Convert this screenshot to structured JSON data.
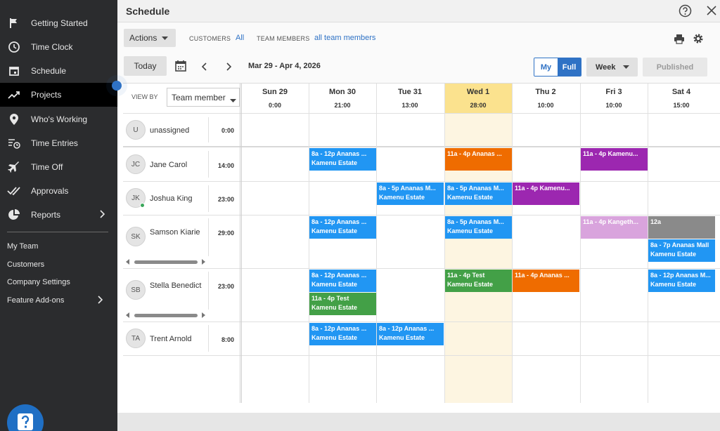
{
  "sidebar": {
    "items": [
      {
        "label": "Getting Started",
        "icon": "flag-icon"
      },
      {
        "label": "Time Clock",
        "icon": "clock-icon"
      },
      {
        "label": "Schedule",
        "icon": "calendar-icon"
      },
      {
        "label": "Projects",
        "icon": "trending-icon"
      },
      {
        "label": "Who's Working",
        "icon": "location-pin-icon"
      },
      {
        "label": "Time Entries",
        "icon": "time-entries-icon"
      },
      {
        "label": "Time Off",
        "icon": "airplane-icon"
      },
      {
        "label": "Approvals",
        "icon": "double-check-icon"
      },
      {
        "label": "Reports",
        "icon": "pie-chart-icon"
      }
    ],
    "active_item": "Projects",
    "links": [
      {
        "label": "My Team"
      },
      {
        "label": "Customers"
      },
      {
        "label": "Company Settings"
      },
      {
        "label": "Feature Add-ons"
      }
    ]
  },
  "header": {
    "title": "Schedule"
  },
  "toolbar": {
    "actions_label": "Actions",
    "customers_label": "CUSTOMERS",
    "customers_value": "All",
    "team_members_label": "TEAM MEMBERS",
    "team_members_value": "all team members",
    "today_label": "Today",
    "date_range": "Mar 29 - Apr 4, 2026",
    "view_my": "My",
    "view_full": "Full",
    "period": "Week",
    "published": "Published"
  },
  "grid": {
    "view_by_label": "VIEW BY",
    "view_by_value": "Team member",
    "days": [
      {
        "name": "Sun 29",
        "hours": "0:00"
      },
      {
        "name": "Mon 30",
        "hours": "21:00"
      },
      {
        "name": "Tue 31",
        "hours": "13:00"
      },
      {
        "name": "Wed 1",
        "hours": "28:00",
        "today": true
      },
      {
        "name": "Thu 2",
        "hours": "10:00"
      },
      {
        "name": "Fri 3",
        "hours": "10:00"
      },
      {
        "name": "Sat 4",
        "hours": "15:00"
      }
    ],
    "members": [
      {
        "initials": "U",
        "name": "unassigned",
        "hours": "0:00"
      },
      {
        "initials": "JC",
        "name": "Jane Carol",
        "hours": "14:00"
      },
      {
        "initials": "JK",
        "name": "Joshua King",
        "hours": "23:00",
        "online": true
      },
      {
        "initials": "SK",
        "name": "Samson Kiarie",
        "hours": "29:00"
      },
      {
        "initials": "SB",
        "name": "Stella Benedict",
        "hours": "23:00"
      },
      {
        "initials": "TA",
        "name": "Trent Arnold",
        "hours": "8:00"
      }
    ],
    "shifts": [
      {
        "member": 1,
        "day": 1,
        "line1": "8a - 12p Ananas ...",
        "line2": "Kamenu Estate",
        "color": "#2196f3"
      },
      {
        "member": 1,
        "day": 3,
        "line1": "11a - 4p Ananas ...",
        "line2": "",
        "color": "#ef6c00"
      },
      {
        "member": 1,
        "day": 5,
        "line1": "11a - 4p Kamenu...",
        "line2": "",
        "color": "#9c27b0"
      },
      {
        "member": 2,
        "day": 2,
        "line1": "8a - 5p Ananas M...",
        "line2": "Kamenu Estate",
        "color": "#2196f3"
      },
      {
        "member": 2,
        "day": 3,
        "line1": "8a - 5p Ananas M...",
        "line2": "Kamenu Estate",
        "color": "#2196f3"
      },
      {
        "member": 2,
        "day": 4,
        "line1": "11a - 4p Kamenu...",
        "line2": "",
        "color": "#9c27b0"
      },
      {
        "member": 3,
        "day": 1,
        "line1": "8a - 12p Ananas ...",
        "line2": "Kamenu Estate",
        "color": "#2196f3"
      },
      {
        "member": 3,
        "day": 3,
        "line1": "8a - 5p Ananas M...",
        "line2": "Kamenu Estate",
        "color": "#2196f3"
      },
      {
        "member": 3,
        "day": 5,
        "line1": "11a - 4p Kangeth...",
        "line2": "",
        "color": "#d9a4dd"
      },
      {
        "member": 3,
        "day": 6,
        "line1": "12a",
        "line2": "",
        "color": "#8a8a8a"
      },
      {
        "member": 3,
        "day": 6,
        "slot": 1,
        "line1": "8a - 7p Ananas Mall",
        "line2": "Kamenu Estate",
        "color": "#2196f3"
      },
      {
        "member": 4,
        "day": 1,
        "line1": "8a - 12p Ananas ...",
        "line2": "Kamenu Estate",
        "color": "#2196f3"
      },
      {
        "member": 4,
        "day": 1,
        "slot": 1,
        "line1": "11a - 4p Test",
        "line2": "Kamenu Estate",
        "color": "#43a047"
      },
      {
        "member": 4,
        "day": 3,
        "line1": "11a - 4p Test",
        "line2": "Kamenu Estate",
        "color": "#43a047"
      },
      {
        "member": 4,
        "day": 4,
        "line1": "11a - 4p Ananas ...",
        "line2": "",
        "color": "#ef6c00"
      },
      {
        "member": 4,
        "day": 6,
        "line1": "8a - 12p Ananas M...",
        "line2": "Kamenu Estate",
        "color": "#2196f3"
      },
      {
        "member": 5,
        "day": 1,
        "line1": "8a - 12p Ananas ...",
        "line2": "Kamenu Estate",
        "color": "#2196f3"
      },
      {
        "member": 5,
        "day": 2,
        "line1": "8a - 12p Ananas ...",
        "line2": "Kamenu Estate",
        "color": "#2196f3"
      }
    ]
  }
}
